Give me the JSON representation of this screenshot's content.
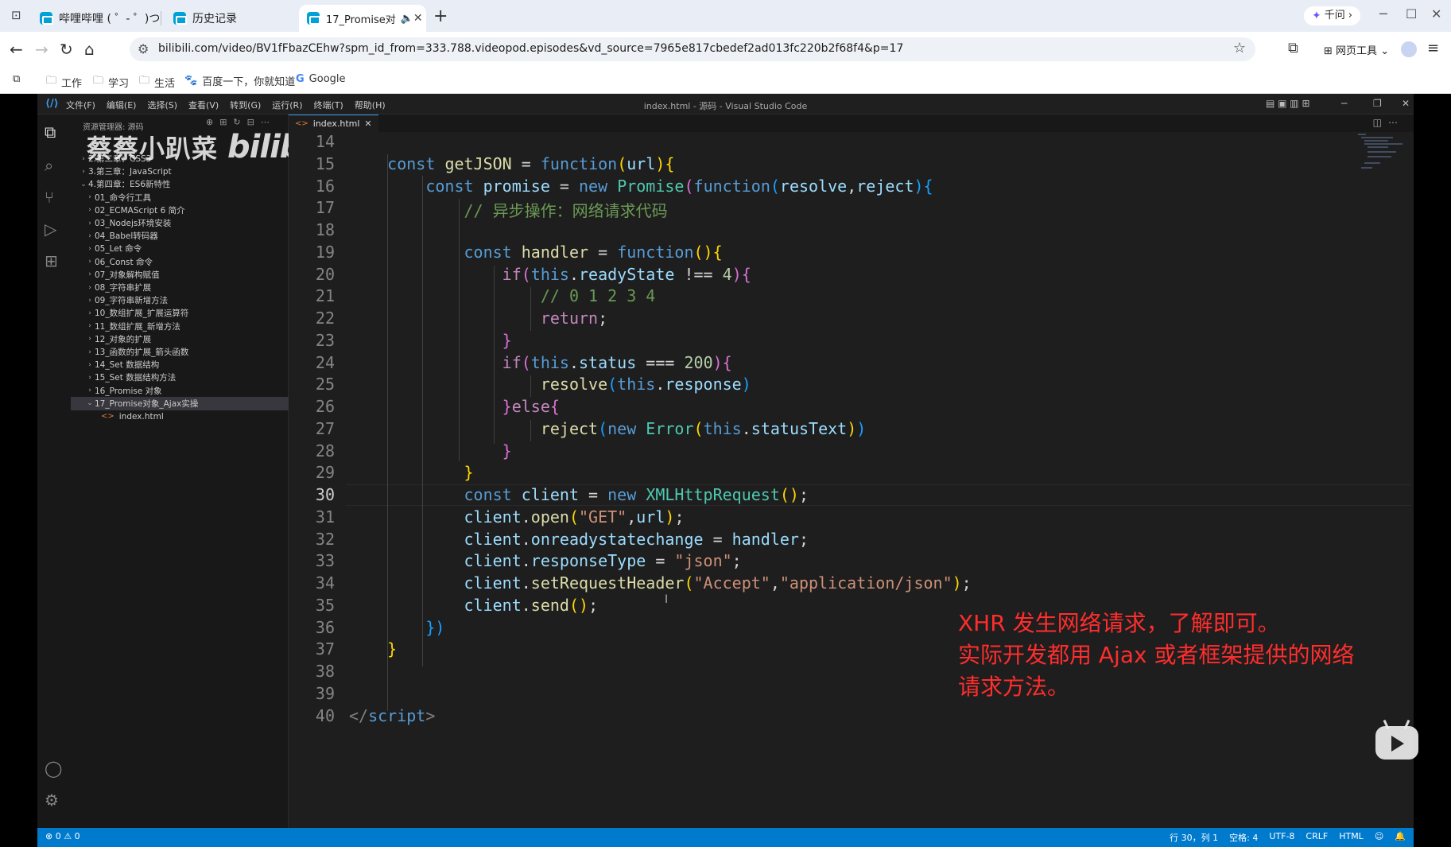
{
  "browser": {
    "tabs": [
      {
        "title": "哔哩哔哩 ( ゜- ゜)つロ"
      },
      {
        "title": "历史记录"
      },
      {
        "title": "17_Promise对"
      }
    ],
    "qianwen": "千问",
    "url": "bilibili.com/video/BV1fFbazCEhw?spm_id_from=333.788.videopod.episodes&vd_source=7965e817cbedef2ad013fc220b2f68f4&p=17",
    "web_tools": "网页工具",
    "bookmarks": [
      "工作",
      "学习",
      "生活",
      "百度一下，你就知道",
      "Google"
    ]
  },
  "vscode": {
    "menu": [
      "文件(F)",
      "编辑(E)",
      "选择(S)",
      "查看(V)",
      "转到(G)",
      "运行(R)",
      "终端(T)",
      "帮助(H)"
    ],
    "window_title": "index.html - 源码 - Visual Studio Code",
    "explorer_title": "资源管理器: 源码",
    "tree": [
      {
        "label": "2.第二章：CSS3",
        "chev": "›",
        "indent": 1
      },
      {
        "label": "3.第三章：JavaScript",
        "chev": "›",
        "indent": 1
      },
      {
        "label": "4.第四章：ES6新特性",
        "chev": "⌄",
        "indent": 1
      },
      {
        "label": "01_命令行工具",
        "chev": "›",
        "indent": 2
      },
      {
        "label": "02_ECMAScript 6 简介",
        "chev": "›",
        "indent": 2
      },
      {
        "label": "03_Nodejs环境安装",
        "chev": "›",
        "indent": 2
      },
      {
        "label": "04_Babel转码器",
        "chev": "›",
        "indent": 2
      },
      {
        "label": "05_Let 命令",
        "chev": "›",
        "indent": 2
      },
      {
        "label": "06_Const 命令",
        "chev": "›",
        "indent": 2
      },
      {
        "label": "07_对象解构赋值",
        "chev": "›",
        "indent": 2
      },
      {
        "label": "08_字符串扩展",
        "chev": "›",
        "indent": 2
      },
      {
        "label": "09_字符串新增方法",
        "chev": "›",
        "indent": 2
      },
      {
        "label": "10_数组扩展_扩展运算符",
        "chev": "›",
        "indent": 2
      },
      {
        "label": "11_数组扩展_新增方法",
        "chev": "›",
        "indent": 2
      },
      {
        "label": "12_对象的扩展",
        "chev": "›",
        "indent": 2
      },
      {
        "label": "13_函数的扩展_箭头函数",
        "chev": "›",
        "indent": 2
      },
      {
        "label": "14_Set 数据结构",
        "chev": "›",
        "indent": 2
      },
      {
        "label": "15_Set 数据结构方法",
        "chev": "›",
        "indent": 2
      },
      {
        "label": "16_Promise 对象",
        "chev": "›",
        "indent": 2
      },
      {
        "label": "17_Promise对象_Ajax实操",
        "chev": "⌄",
        "indent": 2,
        "selected": true
      },
      {
        "label": "index.html",
        "chev": "",
        "indent": 3,
        "file": true
      }
    ],
    "watermark": {
      "text": "蔡蔡小趴菜",
      "logo": "bilibili"
    },
    "editor_tab": "index.html",
    "code_lines": [
      {
        "n": "14",
        "html": ""
      },
      {
        "n": "15",
        "html": "    <span class='k'>const</span> <span class='f'>getJSON</span> = <span class='k'>function</span><span class='b1'>(</span><span class='v'>url</span><span class='b1'>){</span>"
      },
      {
        "n": "16",
        "html": "        <span class='k'>const</span> <span class='v'>promise</span> = <span class='k'>new</span> <span class='t'>Promise</span><span class='b2'>(</span><span class='k'>function</span><span class='b3'>(</span><span class='v'>resolve</span>,<span class='v'>reject</span><span class='b3'>){</span>"
      },
      {
        "n": "17",
        "html": "            <span class='cm'>// 异步操作：网络请求代码</span>"
      },
      {
        "n": "18",
        "html": ""
      },
      {
        "n": "19",
        "html": "            <span class='k'>const</span> <span class='f'>handler</span> = <span class='k'>function</span><span class='b1'>(){</span>"
      },
      {
        "n": "20",
        "html": "                <span class='c'>if</span><span class='b2'>(</span><span class='k'>this</span>.<span class='v'>readyState</span> !== <span class='n'>4</span><span class='b2'>){</span>"
      },
      {
        "n": "21",
        "html": "                    <span class='cm'>// 0 1 2 3 4</span>"
      },
      {
        "n": "22",
        "html": "                    <span class='c'>return</span>;"
      },
      {
        "n": "23",
        "html": "                <span class='b2'>}</span>"
      },
      {
        "n": "24",
        "html": "                <span class='c'>if</span><span class='b2'>(</span><span class='k'>this</span>.<span class='v'>status</span> === <span class='n'>200</span><span class='b2'>){</span>"
      },
      {
        "n": "25",
        "html": "                    <span class='f'>resolve</span><span class='b3'>(</span><span class='k'>this</span>.<span class='v'>response</span><span class='b3'>)</span>"
      },
      {
        "n": "26",
        "html": "                <span class='b2'>}</span><span class='c'>else</span><span class='b2'>{</span>"
      },
      {
        "n": "27",
        "html": "                    <span class='f'>reject</span><span class='b3'>(</span><span class='k'>new</span> <span class='t'>Error</span><span class='b1'>(</span><span class='k'>this</span>.<span class='v'>statusText</span><span class='b1'>)</span><span class='b3'>)</span>"
      },
      {
        "n": "28",
        "html": "                <span class='b2'>}</span>"
      },
      {
        "n": "29",
        "html": "            <span class='b1'>}</span>"
      },
      {
        "n": "30",
        "html": "            <span class='k'>const</span> <span class='v'>client</span> = <span class='k'>new</span> <span class='t'>XMLHttpRequest</span><span class='b1'>()</span>;",
        "current": true
      },
      {
        "n": "31",
        "html": "            <span class='v'>client</span>.<span class='f'>open</span><span class='b1'>(</span><span class='s'>\"GET\"</span>,<span class='v'>url</span><span class='b1'>)</span>;"
      },
      {
        "n": "32",
        "html": "            <span class='v'>client</span>.<span class='v'>onreadystatechange</span> = <span class='v'>handler</span>;"
      },
      {
        "n": "33",
        "html": "            <span class='v'>client</span>.<span class='v'>responseType</span> = <span class='s'>\"json\"</span>;"
      },
      {
        "n": "34",
        "html": "            <span class='v'>client</span>.<span class='f'>setRequestHeader</span><span class='b1'>(</span><span class='s'>\"Accept\"</span>,<span class='s'>\"application/json\"</span><span class='b1'>)</span>;"
      },
      {
        "n": "35",
        "html": "            <span class='v'>client</span>.<span class='f'>send</span><span class='b1'>()</span>;"
      },
      {
        "n": "36",
        "html": "        <span class='b3'>})</span>"
      },
      {
        "n": "37",
        "html": "    <span class='b1'>}</span>"
      },
      {
        "n": "38",
        "html": ""
      },
      {
        "n": "39",
        "html": ""
      },
      {
        "n": "40",
        "html": "<span class='tg'>&lt;/</span><span class='sc'>script</span><span class='tg'>&gt;</span>"
      }
    ],
    "overlay_note": [
      "XHR 发生网络请求，了解即可。",
      "实际开发都用 Ajax 或者框架提供的网络",
      "请求方法。"
    ],
    "status_left": "⊗ 0 ⚠ 0",
    "status_right": [
      "行 30，列 1",
      "空格: 4",
      "UTF-8",
      "CRLF",
      "HTML"
    ]
  },
  "colors": {
    "accent": "#007acc",
    "note": "#ff2d2d",
    "bili": "#00a1d6"
  }
}
